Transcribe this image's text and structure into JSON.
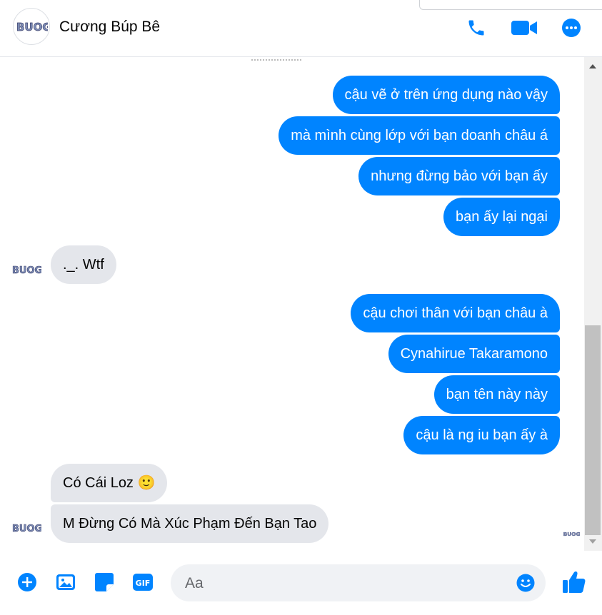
{
  "header": {
    "contact_name": "Cương Búp Bê",
    "avatar_text": "BUOG",
    "accent_color": "#0084ff",
    "actions": [
      "phone-icon",
      "video-camera-icon",
      "more-options-icon"
    ]
  },
  "messages": [
    {
      "side": "out",
      "text": "cậu vẽ ở trên ứng dụng nào vậy"
    },
    {
      "side": "out",
      "text": "mà mình cùng lớp với bạn doanh châu á"
    },
    {
      "side": "out",
      "text": "nhưng đừng bảo với bạn ấy"
    },
    {
      "side": "out",
      "text": "bạn ấy lại ngại"
    },
    {
      "side": "in",
      "text": "._. Wtf"
    },
    {
      "side": "out",
      "text": "cậu chơi thân với bạn châu à"
    },
    {
      "side": "out",
      "text": "Cynahirue Takaramono"
    },
    {
      "side": "out",
      "text": "bạn tên này này"
    },
    {
      "side": "out",
      "text": "cậu là ng iu bạn ấy à"
    },
    {
      "side": "in",
      "text": "Có Cái Loz 🙂"
    },
    {
      "side": "in",
      "text": "M Đừng Có Mà Xúc Phạm Đến Bạn Tao"
    }
  ],
  "composer": {
    "placeholder": "Aa",
    "gif_label": "GIF",
    "actions": [
      "plus-icon",
      "photo-icon",
      "sticker-icon",
      "gif-icon"
    ],
    "send": "thumbs-up-icon"
  },
  "colors": {
    "outgoing_bubble": "#0084ff",
    "incoming_bubble": "#e4e6eb"
  }
}
